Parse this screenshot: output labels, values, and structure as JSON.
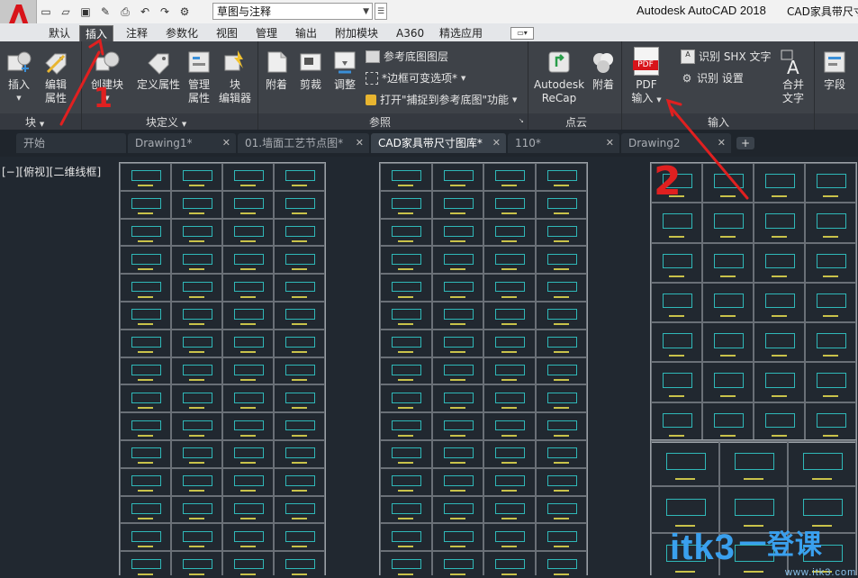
{
  "titlebar": {
    "workspace": "草图与注释",
    "app_title": "Autodesk AutoCAD 2018",
    "doc_title": "CAD家具带尺寸"
  },
  "ribbon_tabs": [
    "默认",
    "插入",
    "注释",
    "参数化",
    "视图",
    "管理",
    "输出",
    "附加模块",
    "A360",
    "精选应用"
  ],
  "ribbon": {
    "block": {
      "insert": "插入",
      "edit_attr": "编辑\n属性",
      "label": "块"
    },
    "block_def": {
      "create": "创建块",
      "define_attr": "定义属性",
      "manage_attr": "管理\n属性",
      "block_editor": "块\n编辑器",
      "label": "块定义"
    },
    "reference": {
      "attach": "附着",
      "clip": "剪裁",
      "adjust": "调整",
      "underlay_layers": "参考底图图层",
      "frames": "*边框可变选项*",
      "snap": "打开\"捕捉到参考底图\"功能",
      "label": "参照"
    },
    "pointcloud": {
      "recap": "Autodesk\nReCap",
      "attach": "附着",
      "label": "点云"
    },
    "import": {
      "pdf_icon_text": "PDF",
      "pdf": "PDF\n输入",
      "shx_text": "识别 SHX 文字",
      "settings": "识别 设置",
      "combine_text": "合并\n文字",
      "field": "字段",
      "label": "输入"
    }
  },
  "doc_tabs": [
    {
      "label": "开始",
      "active": false,
      "close": false
    },
    {
      "label": "Drawing1*",
      "active": false,
      "close": true
    },
    {
      "label": "01.墙面工艺节点图*",
      "active": false,
      "close": true
    },
    {
      "label": "CAD家具带尺寸图库*",
      "active": true,
      "close": true
    },
    {
      "label": "110*",
      "active": false,
      "close": true
    },
    {
      "label": "Drawing2",
      "active": false,
      "close": true
    }
  ],
  "viewport_label": "[−][俯视][二维线框]",
  "annotations": {
    "mark_1": "1",
    "mark_2": "2"
  },
  "watermark": {
    "brand": "itk3",
    "suffix": "一登课",
    "url": "www.itk3.com"
  },
  "colors": {
    "accent_red": "#e02020",
    "active_tab": "#44474c",
    "ribbon_bg": "#3e4248",
    "canvas_bg": "#212830"
  }
}
